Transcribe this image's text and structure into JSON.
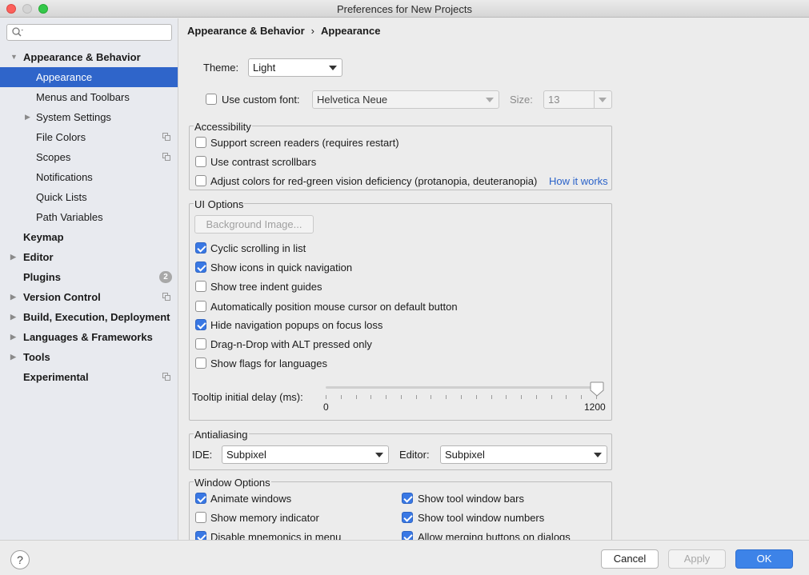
{
  "window": {
    "title": "Preferences for New Projects"
  },
  "search": {
    "placeholder": "",
    "value": ""
  },
  "sidebar": {
    "items": [
      {
        "label": "Appearance & Behavior",
        "expanded": true
      },
      {
        "label": "Appearance",
        "selected": true
      },
      {
        "label": "Menus and Toolbars"
      },
      {
        "label": "System Settings"
      },
      {
        "label": "File Colors"
      },
      {
        "label": "Scopes"
      },
      {
        "label": "Notifications"
      },
      {
        "label": "Quick Lists"
      },
      {
        "label": "Path Variables"
      },
      {
        "label": "Keymap"
      },
      {
        "label": "Editor"
      },
      {
        "label": "Plugins",
        "badge": "2"
      },
      {
        "label": "Version Control"
      },
      {
        "label": "Build, Execution, Deployment"
      },
      {
        "label": "Languages & Frameworks"
      },
      {
        "label": "Tools"
      },
      {
        "label": "Experimental"
      }
    ]
  },
  "breadcrumb": {
    "parent": "Appearance & Behavior",
    "separator": "›",
    "current": "Appearance"
  },
  "theme": {
    "label": "Theme:",
    "value": "Light"
  },
  "custom_font": {
    "label": "Use custom font:",
    "checked": false,
    "font_value": "Helvetica Neue",
    "size_label": "Size:",
    "size_value": "13"
  },
  "accessibility": {
    "title": "Accessibility",
    "screen_readers": {
      "label": "Support screen readers (requires restart)",
      "checked": false
    },
    "contrast_scrollbars": {
      "label": "Use contrast scrollbars",
      "checked": false
    },
    "adjust_colors": {
      "label": "Adjust colors for red-green vision deficiency (protanopia, deuteranopia)",
      "checked": false
    },
    "how_it_works": "How it works"
  },
  "ui_options": {
    "title": "UI Options",
    "background_image": "Background Image...",
    "cyclic_scrolling": {
      "label": "Cyclic scrolling in list",
      "checked": true
    },
    "show_icons": {
      "label": "Show icons in quick navigation",
      "checked": true
    },
    "tree_indent": {
      "label": "Show tree indent guides",
      "checked": false
    },
    "auto_cursor": {
      "label": "Automatically position mouse cursor on default button",
      "checked": false
    },
    "hide_popups": {
      "label": "Hide navigation popups on focus loss",
      "checked": true
    },
    "drag_drop": {
      "label": "Drag-n-Drop with ALT pressed only",
      "checked": false
    },
    "show_flags": {
      "label": "Show flags for languages",
      "checked": false
    },
    "tooltip": {
      "label": "Tooltip initial delay (ms):",
      "min": "0",
      "max": "1200",
      "value": 1200
    }
  },
  "antialiasing": {
    "title": "Antialiasing",
    "ide_label": "IDE:",
    "ide_value": "Subpixel",
    "editor_label": "Editor:",
    "editor_value": "Subpixel"
  },
  "window_options": {
    "title": "Window Options",
    "animate": {
      "label": "Animate windows",
      "checked": true
    },
    "memory": {
      "label": "Show memory indicator",
      "checked": false
    },
    "mnemonics": {
      "label": "Disable mnemonics in menu",
      "checked": true
    },
    "tool_bars": {
      "label": "Show tool window bars",
      "checked": true
    },
    "tool_numbers": {
      "label": "Show tool window numbers",
      "checked": true
    },
    "merging": {
      "label": "Allow merging buttons on dialogs",
      "checked": true
    }
  },
  "footer": {
    "help": "?",
    "cancel": "Cancel",
    "apply": "Apply",
    "ok": "OK"
  },
  "colors": {
    "accent": "#3978e4",
    "selection": "#2f65ca",
    "link": "#2a62c9",
    "primary_button": "#3d83e8"
  }
}
